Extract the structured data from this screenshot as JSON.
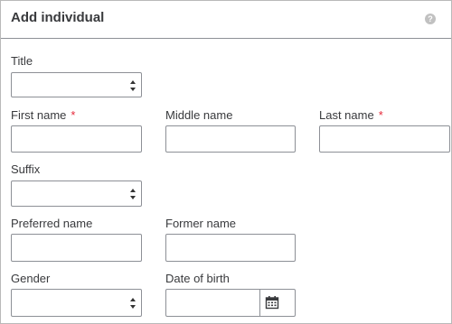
{
  "dialog": {
    "title": "Add individual",
    "help_icon": "question-circle-icon",
    "help_symbol": "?"
  },
  "form": {
    "title_label": "Title",
    "title_value": "",
    "first_name_label": "First name",
    "middle_name_label": "Middle name",
    "last_name_label": "Last name",
    "required_marker": "*",
    "suffix_label": "Suffix",
    "suffix_value": "",
    "preferred_name_label": "Preferred name",
    "former_name_label": "Former name",
    "gender_label": "Gender",
    "gender_value": "",
    "dob_label": "Date of birth",
    "dob_icon": "calendar-icon"
  },
  "colors": {
    "required": "#e6293a",
    "border": "#8d9096",
    "text": "#393a3d"
  }
}
